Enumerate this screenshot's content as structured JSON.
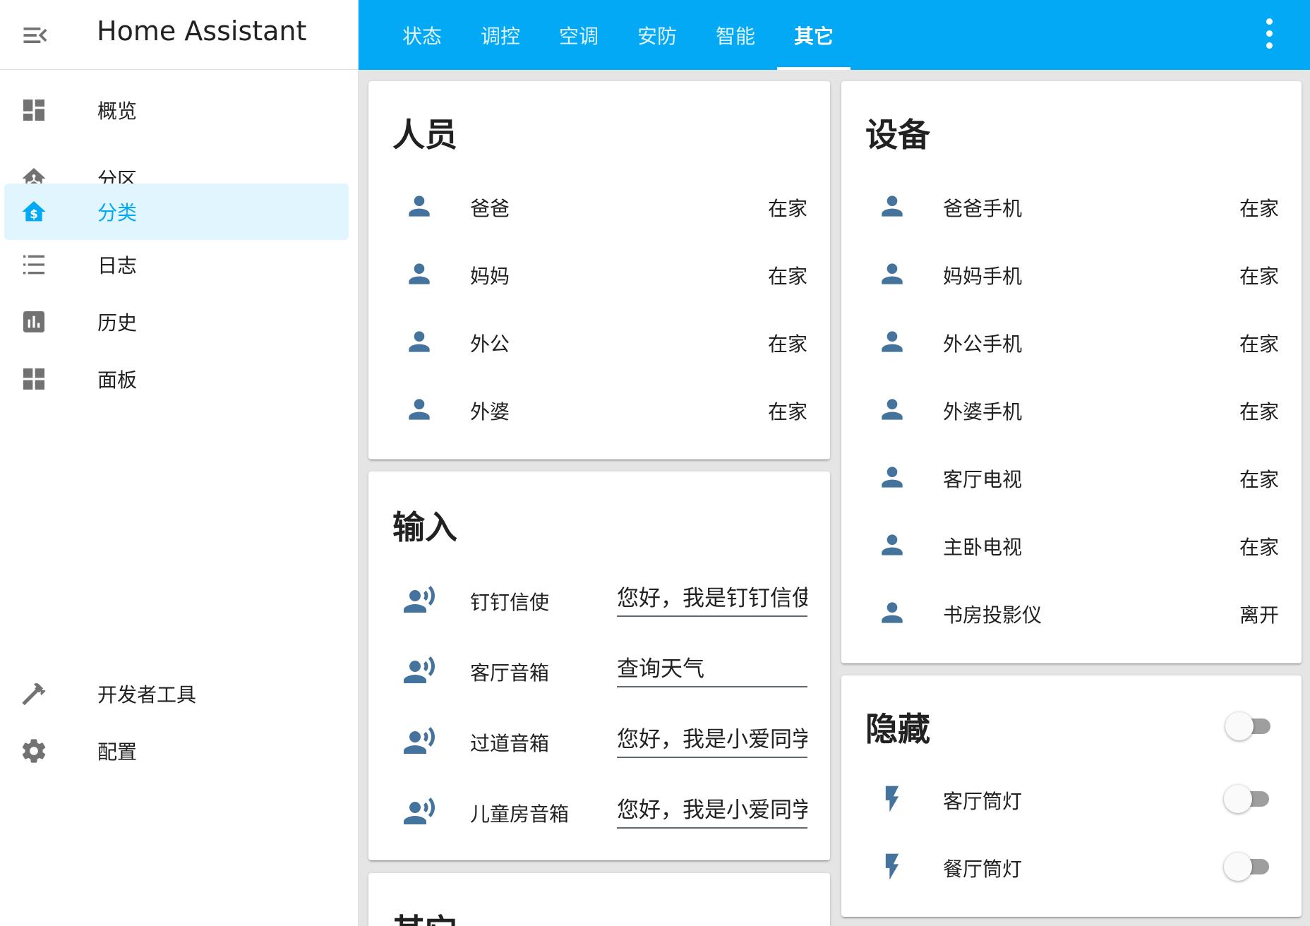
{
  "app": {
    "title": "Home Assistant"
  },
  "sidebar": {
    "items": [
      {
        "label": "概览",
        "icon": "dashboard-icon"
      },
      {
        "label": "分区",
        "icon": "home-network-icon"
      },
      {
        "label": "分类",
        "icon": "home-dollar-icon",
        "active": true
      },
      {
        "label": "日志",
        "icon": "format-list-icon"
      },
      {
        "label": "历史",
        "icon": "chart-box-icon"
      },
      {
        "label": "面板",
        "icon": "view-grid-icon"
      }
    ],
    "bottom_items": [
      {
        "label": "开发者工具",
        "icon": "hammer-icon"
      },
      {
        "label": "配置",
        "icon": "gear-icon"
      }
    ]
  },
  "tabs": [
    {
      "label": "状态"
    },
    {
      "label": "调控"
    },
    {
      "label": "空调"
    },
    {
      "label": "安防"
    },
    {
      "label": "智能"
    },
    {
      "label": "其它",
      "active": true
    }
  ],
  "cards": {
    "people": {
      "title": "人员",
      "rows": [
        {
          "name": "爸爸",
          "state": "在家"
        },
        {
          "name": "妈妈",
          "state": "在家"
        },
        {
          "name": "外公",
          "state": "在家"
        },
        {
          "name": "外婆",
          "state": "在家"
        }
      ]
    },
    "inputs": {
      "title": "输入",
      "rows": [
        {
          "name": "钉钉信使",
          "value": "您好，我是钉钉信使"
        },
        {
          "name": "客厅音箱",
          "value": "查询天气"
        },
        {
          "name": "过道音箱",
          "value": "您好，我是小爱同学"
        },
        {
          "name": "儿童房音箱",
          "value": "您好，我是小爱同学"
        }
      ]
    },
    "other": {
      "title": "其它"
    },
    "devices": {
      "title": "设备",
      "rows": [
        {
          "name": "爸爸手机",
          "state": "在家"
        },
        {
          "name": "妈妈手机",
          "state": "在家"
        },
        {
          "name": "外公手机",
          "state": "在家"
        },
        {
          "name": "外婆手机",
          "state": "在家"
        },
        {
          "name": "客厅电视",
          "state": "在家"
        },
        {
          "name": "主卧电视",
          "state": "在家"
        },
        {
          "name": "书房投影仪",
          "state": "离开"
        }
      ]
    },
    "hidden": {
      "title": "隐藏",
      "header_toggle_on": false,
      "rows": [
        {
          "name": "客厅筒灯",
          "on": false
        },
        {
          "name": "餐厅筒灯",
          "on": false
        }
      ]
    }
  },
  "colors": {
    "accent": "#03a9f4",
    "active_bg": "#e1f5fe",
    "entity_icon": "#44739e",
    "nav_icon": "#727272"
  }
}
